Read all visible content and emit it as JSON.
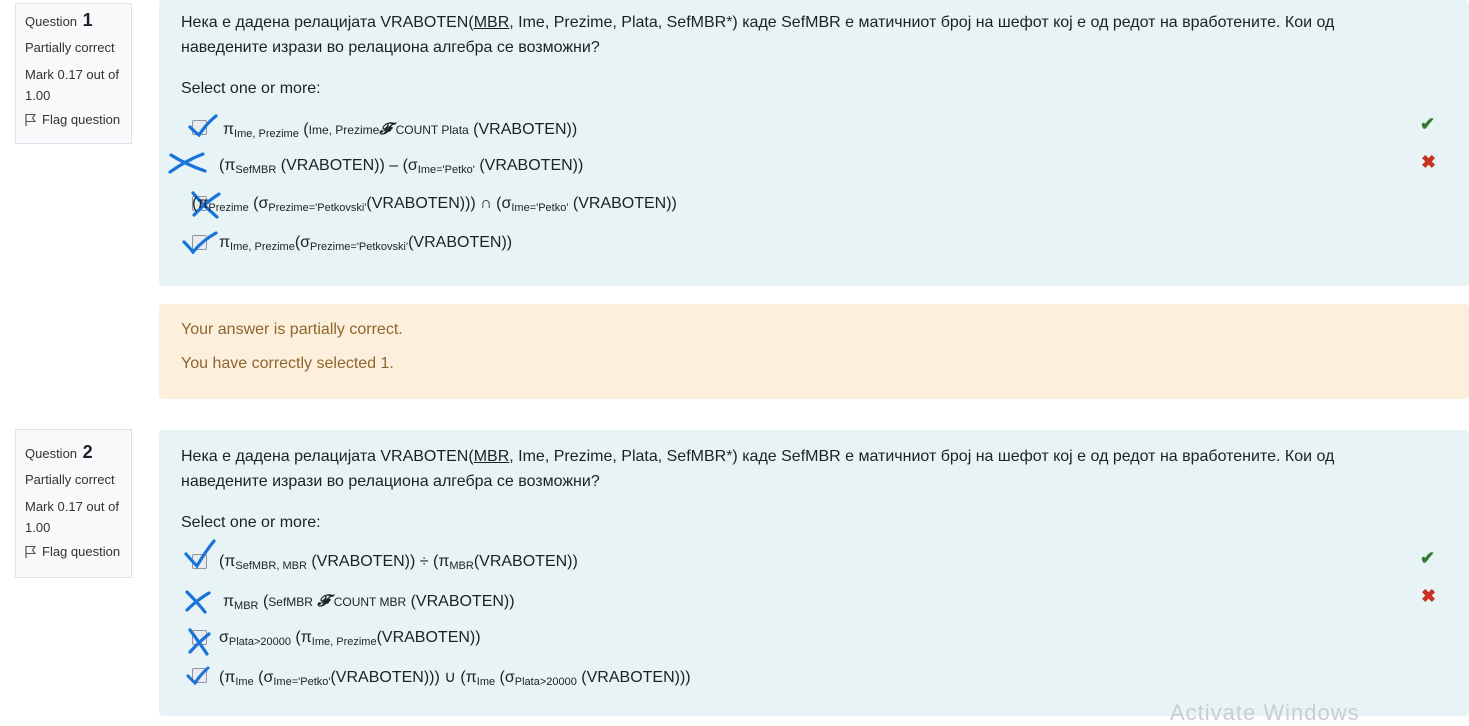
{
  "questions": [
    {
      "label": "Question",
      "number": "1",
      "state": "Partially correct",
      "grade": "Mark 0.17 out of 1.00",
      "flag": "Flag question",
      "text_before": "Нека е дадена релацијата VRABOTEN(",
      "text_key": "MBR",
      "text_after": ", Ime, Prezime, Plata, SefMBR*) каде SefMBR е матичниот број на шефот кој е од редот на вработените. Кои од наведените изрази во релациона алгебра се возможни?",
      "prompt": "Select one or more:",
      "options": [
        {
          "result": "correct-icon"
        },
        {
          "result": "incorrect-icon"
        },
        {
          "result": ""
        },
        {
          "result": ""
        }
      ]
    },
    {
      "label": "Question",
      "number": "2",
      "state": "Partially correct",
      "grade": "Mark 0.17 out of 1.00",
      "flag": "Flag question",
      "text_before": "Нека е дадена релацијата VRABOTEN(",
      "text_key": "MBR",
      "text_after": ", Ime, Prezime, Plata, SefMBR*) каде SefMBR е матичниот број на шефот кој е од редот на вработените. Кои од наведените изрази во релациона алгебра се возможни?",
      "prompt": "Select one or more:",
      "options": [
        {
          "result": "correct-icon"
        },
        {
          "result": "incorrect-icon"
        },
        {
          "result": ""
        },
        {
          "result": ""
        }
      ]
    }
  ],
  "feedback": {
    "line1": "Your answer is partially correct.",
    "line2": "You have correctly selected 1."
  },
  "colors": {
    "correct": "#357a32",
    "incorrect": "#ca3120",
    "annotation_blue": "#1a73d9",
    "content_bg": "#e7f3f5",
    "feedback_bg": "#fcefdc"
  },
  "watermark": "Activate Windows"
}
